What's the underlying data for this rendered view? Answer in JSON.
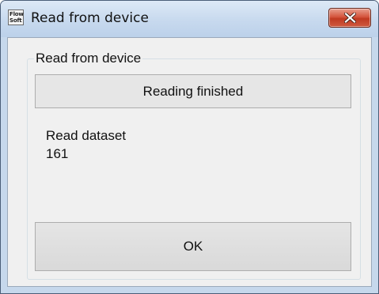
{
  "window": {
    "title": "Read from device",
    "icon_text": "Flow\nSoft",
    "icon": "flowsoft-app-icon",
    "close_icon": "close-icon"
  },
  "group": {
    "legend": "Read from device",
    "status_button_label": "Reading finished"
  },
  "info": {
    "label": "Read dataset",
    "value": "161"
  },
  "ok_button": {
    "label": "OK"
  },
  "colors": {
    "close_button": "#c8452c",
    "titlebar": "#c7d9ee",
    "client_background": "#f0f0f0"
  }
}
